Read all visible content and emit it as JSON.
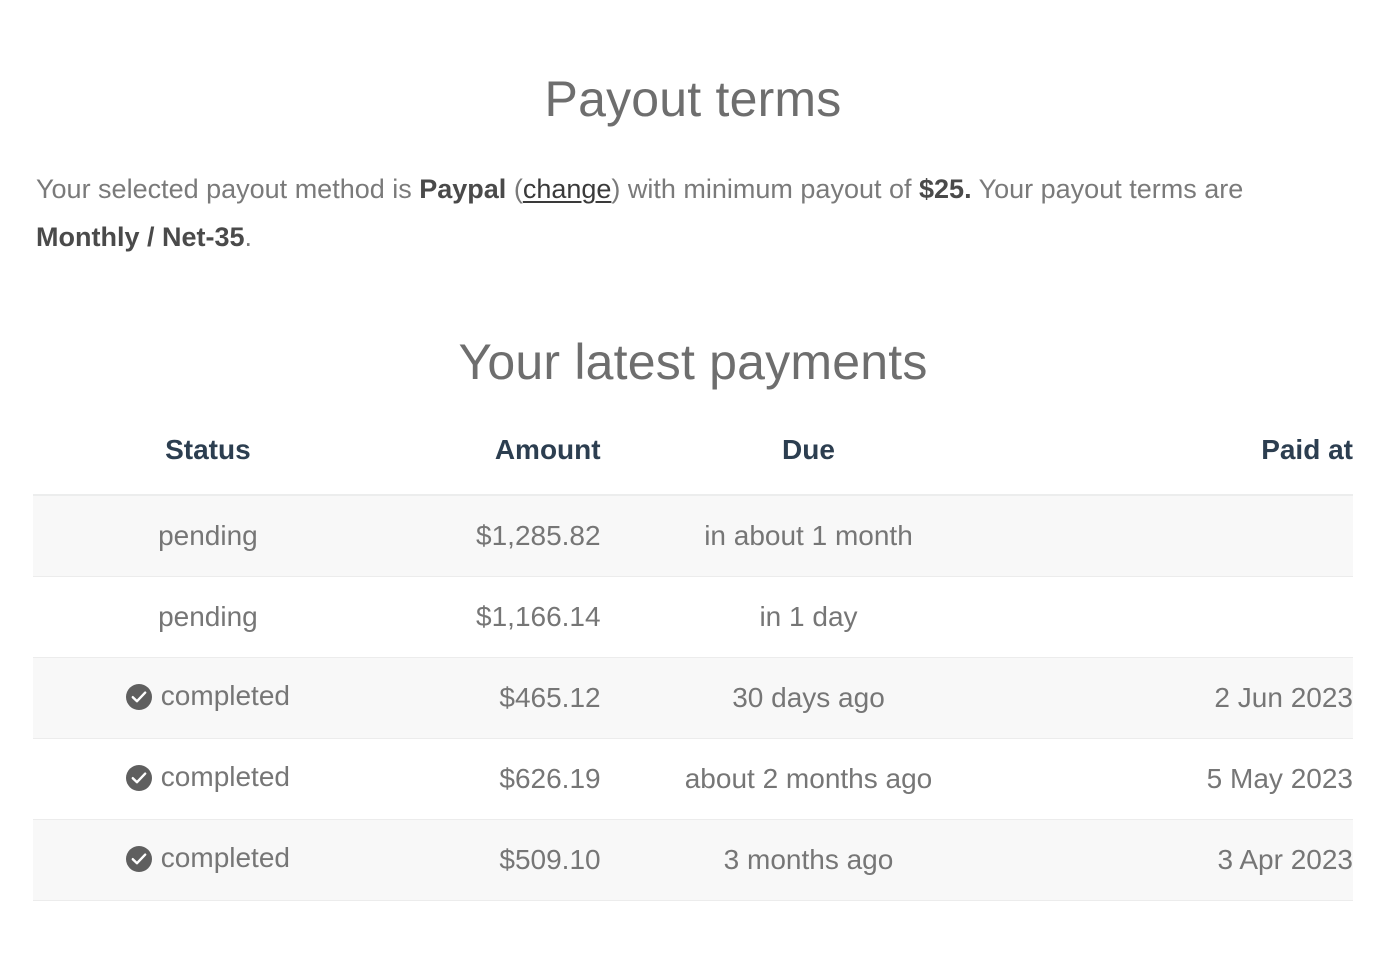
{
  "page": {
    "title": "Payout terms",
    "section_title": "Your latest payments"
  },
  "intro": {
    "part1": "Your selected payout method is ",
    "method": "Paypal",
    "open_paren": " (",
    "change_link": "change",
    "part2": ") with minimum payout of ",
    "minimum": "$25.",
    "part3": " Your payout terms are ",
    "terms": "Monthly / Net-35",
    "part4": "."
  },
  "table": {
    "columns": [
      "Status",
      "Amount",
      "Due",
      "Paid at"
    ],
    "rows": [
      {
        "status": "pending",
        "has_check": false,
        "amount": "$1,285.82",
        "due": "in about 1 month",
        "paid_at": ""
      },
      {
        "status": "pending",
        "has_check": false,
        "amount": "$1,166.14",
        "due": "in 1 day",
        "paid_at": ""
      },
      {
        "status": "completed",
        "has_check": true,
        "amount": "$465.12",
        "due": "30 days ago",
        "paid_at": "2 Jun 2023"
      },
      {
        "status": "completed",
        "has_check": true,
        "amount": "$626.19",
        "due": "about 2 months ago",
        "paid_at": "5 May 2023"
      },
      {
        "status": "completed",
        "has_check": true,
        "amount": "$509.10",
        "due": "3 months ago",
        "paid_at": "3 Apr 2023"
      }
    ]
  },
  "icons": {
    "check_circle": "check-circle-icon"
  },
  "colors": {
    "heading": "#6e6e6e",
    "body_text": "#7a7a7a",
    "strong_text": "#4a4a4a",
    "link": "#3a3a3a",
    "table_header": "#2c3e50",
    "table_cell": "#767676",
    "row_stripe": "#f8f8f8",
    "row_border": "#ececec",
    "header_border": "#eceded",
    "check_icon_fill": "#5f5f5f",
    "background": "#ffffff"
  }
}
